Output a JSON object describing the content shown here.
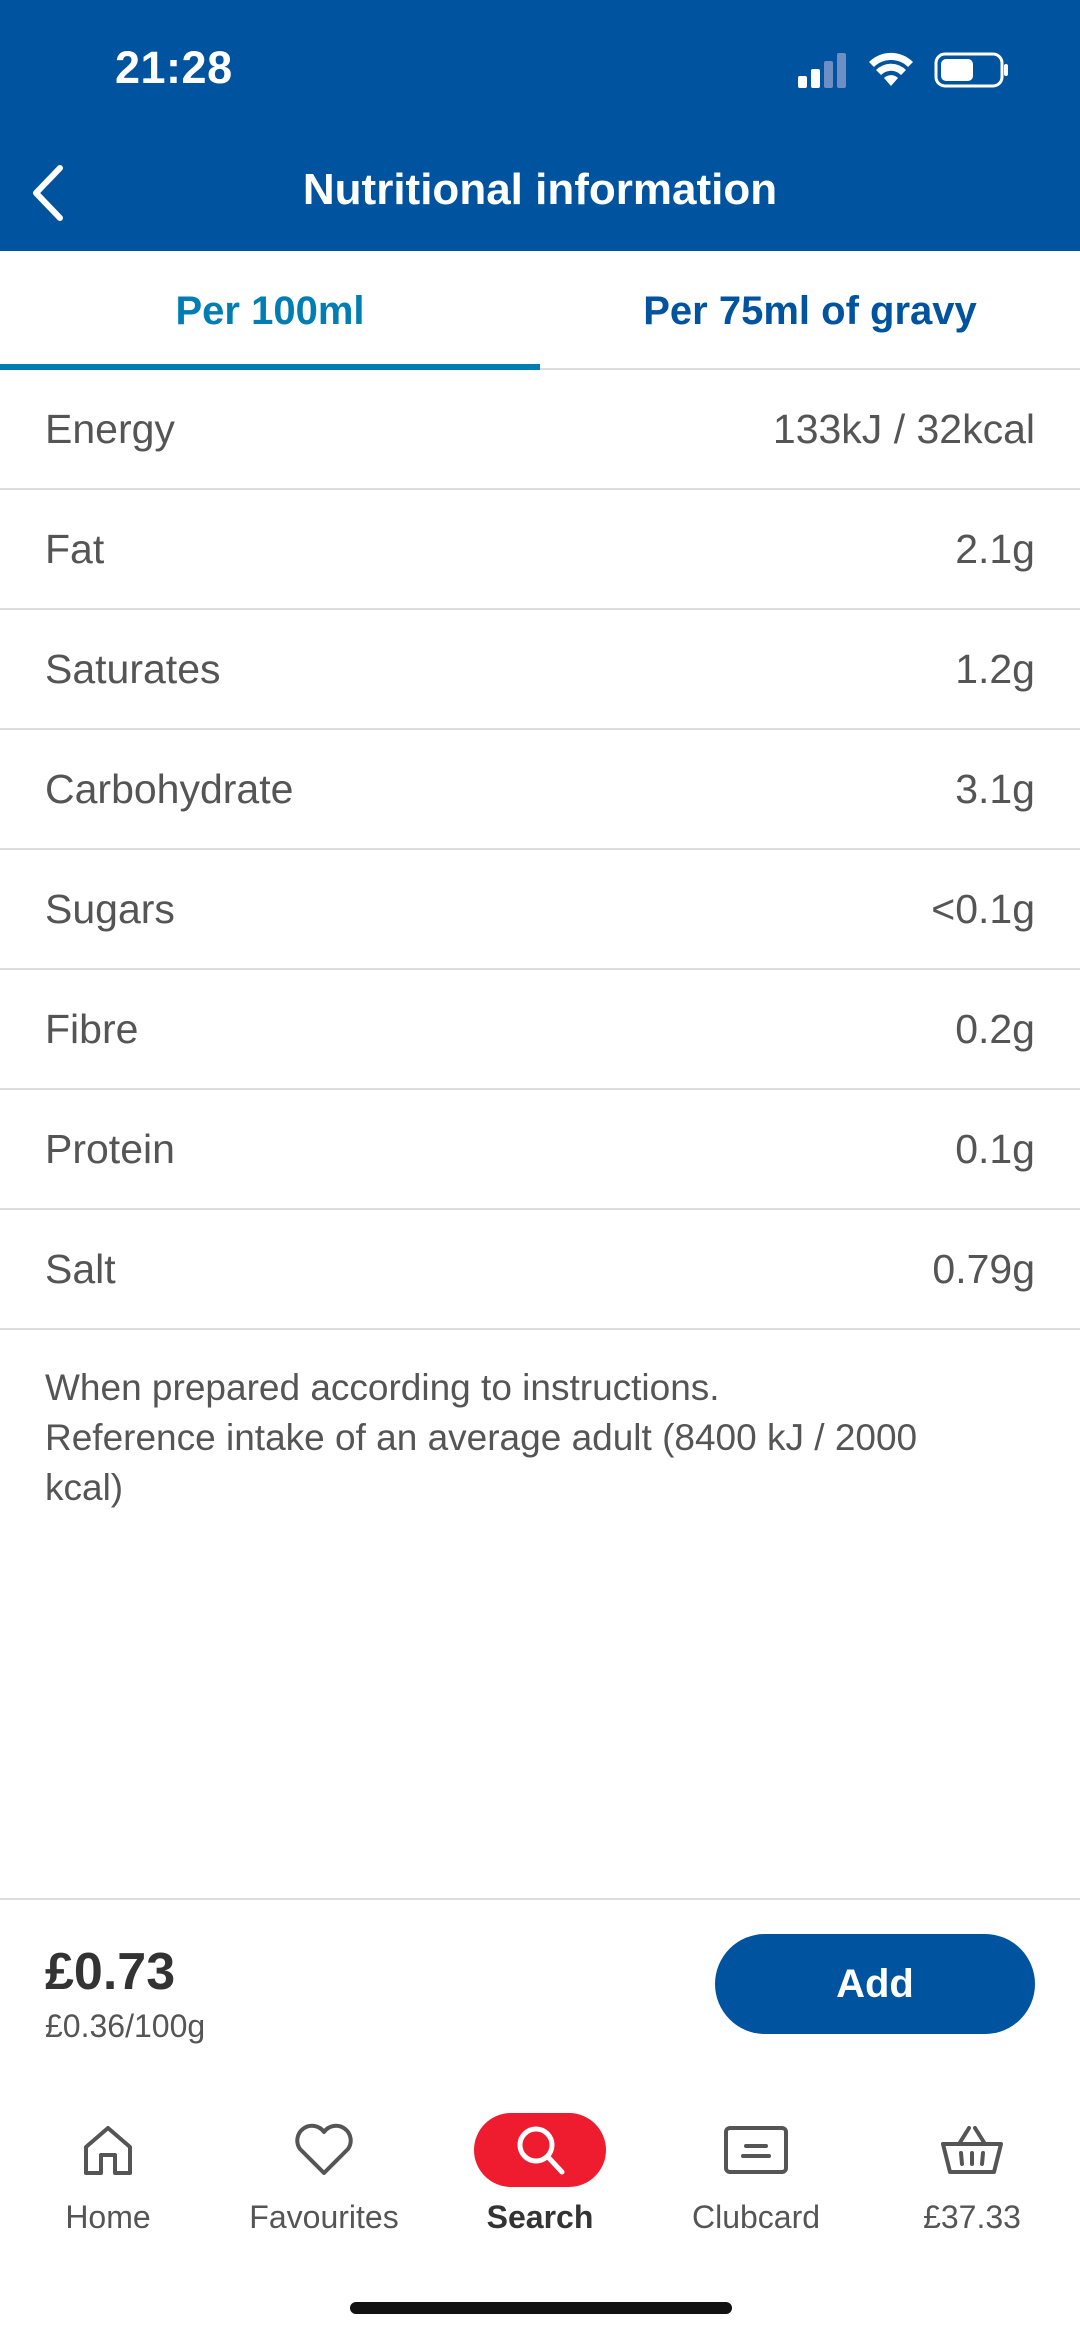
{
  "status_bar": {
    "time": "21:28"
  },
  "header": {
    "title": "Nutritional information"
  },
  "tabs": [
    {
      "label": "Per 100ml",
      "active": true
    },
    {
      "label": "Per 75ml of gravy",
      "active": false
    }
  ],
  "nutrition": [
    {
      "name": "Energy",
      "value": "133kJ / 32kcal"
    },
    {
      "name": "Fat",
      "value": "2.1g"
    },
    {
      "name": "Saturates",
      "value": "1.2g"
    },
    {
      "name": "Carbohydrate",
      "value": "3.1g"
    },
    {
      "name": "Sugars",
      "value": "<0.1g"
    },
    {
      "name": "Fibre",
      "value": "0.2g"
    },
    {
      "name": "Protein",
      "value": "0.1g"
    },
    {
      "name": "Salt",
      "value": "0.79g"
    }
  ],
  "footnote": {
    "line1": "When prepared according to instructions.",
    "line2": "Reference intake of an average adult (8400 kJ / 2000 kcal)"
  },
  "price_bar": {
    "price": "£0.73",
    "unit_price": "£0.36/100g",
    "add_label": "Add"
  },
  "nav": [
    {
      "label": "Home",
      "icon": "home-icon",
      "active": false
    },
    {
      "label": "Favourites",
      "icon": "heart-icon",
      "active": false
    },
    {
      "label": "Search",
      "icon": "search-icon",
      "active": true
    },
    {
      "label": "Clubcard",
      "icon": "clubcard-icon",
      "active": false
    },
    {
      "label": "£37.33",
      "icon": "basket-icon",
      "active": false
    }
  ],
  "colors": {
    "brand_blue": "#00539f",
    "tab_active": "#007eb3",
    "search_red": "#ee1c2e"
  }
}
